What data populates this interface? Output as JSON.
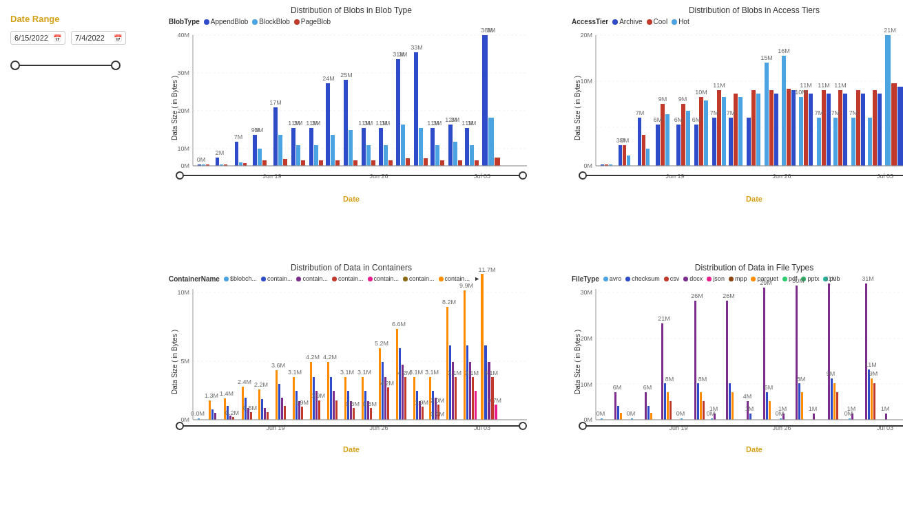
{
  "dateRange": {
    "label": "Date Range",
    "start": "6/15/2022",
    "end": "7/4/2022"
  },
  "charts": {
    "blobType": {
      "title": "Distribution of Blobs in Blob Type",
      "legendLabel": "BlobType",
      "legendItems": [
        {
          "label": "AppendBlob",
          "color": "#2e4bc9"
        },
        {
          "label": "BlockBlob",
          "color": "#4ba3e2"
        },
        {
          "label": "PageBlob",
          "color": "#c0392b"
        }
      ],
      "yAxisLabel": "Data Size ( in Bytes )",
      "xAxisLabel": "Date",
      "xTicks": [
        "Jun 19",
        "Jun 26",
        "Jul 03"
      ],
      "yTicks": [
        "0M",
        "10M",
        "20M",
        "30M",
        "40M"
      ]
    },
    "accessTiers": {
      "title": "Distribution of Blobs in Access Tiers",
      "legendLabel": "AccessTier",
      "legendItems": [
        {
          "label": "Archive",
          "color": "#2e4bc9"
        },
        {
          "label": "Cool",
          "color": "#c0392b"
        },
        {
          "label": "Hot",
          "color": "#4ba3e2"
        }
      ],
      "yAxisLabel": "Data Size ( in Bytes )",
      "xAxisLabel": "Date",
      "xTicks": [
        "Jun 19",
        "Jun 26",
        "Jul 03"
      ],
      "yTicks": [
        "0M",
        "10M",
        "20M"
      ]
    },
    "containers": {
      "title": "Distribution of Data in Containers",
      "legendLabel": "ContainerName",
      "legendItems": [
        {
          "label": "$blobch...",
          "color": "#4ba3e2"
        },
        {
          "label": "contain...",
          "color": "#2e4bc9"
        },
        {
          "label": "contain...",
          "color": "#7b2d8b"
        },
        {
          "label": "contain...",
          "color": "#c0392b"
        },
        {
          "label": "contain...",
          "color": "#e91e8c"
        },
        {
          "label": "contain...",
          "color": "#8b6914"
        },
        {
          "label": "contain...",
          "color": "#ff8c00"
        }
      ],
      "yAxisLabel": "Data Size ( in Bytes )",
      "xAxisLabel": "Date",
      "xTicks": [
        "Jun 19",
        "Jun 26",
        "Jul 03"
      ],
      "yTicks": [
        "0M",
        "5M",
        "10M"
      ]
    },
    "fileTypes": {
      "title": "Distribution of Data in File Types",
      "legendLabel": "FileType",
      "legendItems": [
        {
          "label": "avro",
          "color": "#4ba3e2"
        },
        {
          "label": "checksum",
          "color": "#2e4bc9"
        },
        {
          "label": "csv",
          "color": "#c0392b"
        },
        {
          "label": "docx",
          "color": "#7b2d8b"
        },
        {
          "label": "json",
          "color": "#e91e8c"
        },
        {
          "label": "mpp",
          "color": "#8b4513"
        },
        {
          "label": "parquet",
          "color": "#ff8c00"
        },
        {
          "label": "pdf",
          "color": "#2ecc71"
        },
        {
          "label": "pptx",
          "color": "#27ae60"
        },
        {
          "label": "pub",
          "color": "#1abc9c"
        }
      ],
      "yAxisLabel": "Data Size ( in Bytes )",
      "xAxisLabel": "Date",
      "xTicks": [
        "Jun 19",
        "Jun 26",
        "Jul 03"
      ],
      "yTicks": [
        "0M",
        "10M",
        "20M",
        "30M"
      ]
    }
  }
}
